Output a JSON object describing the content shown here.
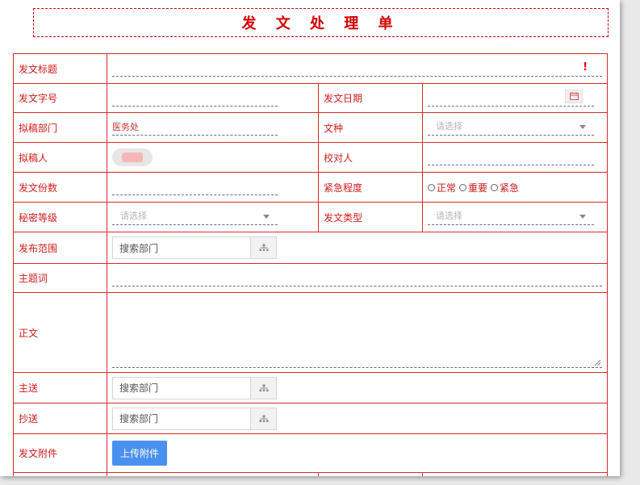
{
  "title": "发 文 处 理 单",
  "required_mark": "!",
  "labels": {
    "doc_title": "发文标题",
    "doc_number": "发文字号",
    "doc_date": "发文日期",
    "draft_dept": "拟稿部门",
    "doc_kind": "文种",
    "drafter": "拟稿人",
    "proofreader": "校对人",
    "copies": "发文份数",
    "urgency": "紧急程度",
    "secrecy": "秘密等级",
    "doc_type": "发文类型",
    "scope": "发布范围",
    "keywords": "主题词",
    "body": "正文",
    "main_send": "主送",
    "cc_send": "抄送",
    "attachment": "发文附件"
  },
  "values": {
    "draft_dept": "医务处"
  },
  "placeholders": {
    "select": "请选择",
    "dept_search": "搜索部门"
  },
  "urgency_options": [
    "正常",
    "重要",
    "紧急"
  ],
  "upload_label": "上传附件",
  "icons": {
    "calendar": "calendar-icon",
    "org": "org-tree-icon",
    "dropdown": "chevron-down-icon"
  },
  "colors": {
    "accent_red": "#d40000",
    "upload_blue": "#4a90f0"
  }
}
